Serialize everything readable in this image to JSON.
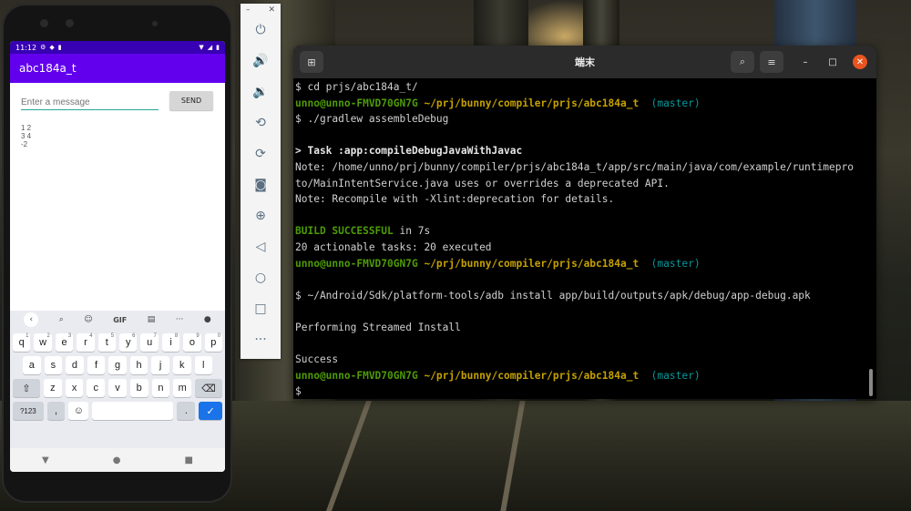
{
  "phone": {
    "status": {
      "time": "11:12"
    },
    "app_title": "abc184a_t",
    "message_placeholder": "Enter a message",
    "send_label": "SEND",
    "output_lines": [
      "1 2",
      "3 4",
      "-2"
    ],
    "keyboard": {
      "suggestions": [
        "GIF"
      ],
      "row1": [
        [
          "q",
          "1"
        ],
        [
          "w",
          "2"
        ],
        [
          "e",
          "3"
        ],
        [
          "r",
          "4"
        ],
        [
          "t",
          "5"
        ],
        [
          "y",
          "6"
        ],
        [
          "u",
          "7"
        ],
        [
          "i",
          "8"
        ],
        [
          "o",
          "9"
        ],
        [
          "p",
          "0"
        ]
      ],
      "row2": [
        "a",
        "s",
        "d",
        "f",
        "g",
        "h",
        "j",
        "k",
        "l"
      ],
      "row3": [
        "z",
        "x",
        "c",
        "v",
        "b",
        "n",
        "m"
      ],
      "sym_label": "?123",
      "comma": ",",
      "period": "."
    }
  },
  "terminal": {
    "title": "端末",
    "lines": [
      [
        {
          "t": "$ cd prjs/abc184a_t/"
        }
      ],
      [
        {
          "t": "unno@unno-FMVD70GN7G",
          "s": "g"
        },
        {
          "t": " ~/prj/bunny/compiler/prjs/abc184a_t",
          "s": "y"
        },
        {
          "t": "  (master)",
          "s": "c"
        }
      ],
      [
        {
          "t": "$ ./gradlew assembleDebug"
        }
      ],
      [
        {
          "t": ""
        }
      ],
      [
        {
          "t": "> Task :app:compileDebugJavaWithJavac",
          "s": "b"
        }
      ],
      [
        {
          "t": "Note: /home/unno/prj/bunny/compiler/prjs/abc184a_t/app/src/main/java/com/example/runtimepro"
        }
      ],
      [
        {
          "t": "to/MainIntentService.java uses or overrides a deprecated API."
        }
      ],
      [
        {
          "t": "Note: Recompile with -Xlint:deprecation for details."
        }
      ],
      [
        {
          "t": ""
        }
      ],
      [
        {
          "t": "BUILD SUCCESSFUL",
          "s": "g"
        },
        {
          "t": " in 7s"
        }
      ],
      [
        {
          "t": "20 actionable tasks: 20 executed"
        }
      ],
      [
        {
          "t": "unno@unno-FMVD70GN7G",
          "s": "g"
        },
        {
          "t": " ~/prj/bunny/compiler/prjs/abc184a_t",
          "s": "y"
        },
        {
          "t": "  (master)",
          "s": "c"
        }
      ],
      [
        {
          "t": ""
        }
      ],
      [
        {
          "t": "$ ~/Android/Sdk/platform-tools/adb install app/build/outputs/apk/debug/app-debug.apk"
        }
      ],
      [
        {
          "t": ""
        }
      ],
      [
        {
          "t": "Performing Streamed Install"
        }
      ],
      [
        {
          "t": ""
        }
      ],
      [
        {
          "t": "Success"
        }
      ],
      [
        {
          "t": "unno@unno-FMVD70GN7G",
          "s": "g"
        },
        {
          "t": " ~/prj/bunny/compiler/prjs/abc184a_t",
          "s": "y"
        },
        {
          "t": "  (master)",
          "s": "c"
        }
      ],
      [
        {
          "t": "$"
        }
      ]
    ]
  },
  "colors": {
    "appbar": "#6200ee",
    "statusbar": "#3700b3",
    "prompt_user": "#4e9a06",
    "prompt_path": "#c4a000",
    "prompt_branch": "#06989a",
    "close_button": "#e95420"
  }
}
